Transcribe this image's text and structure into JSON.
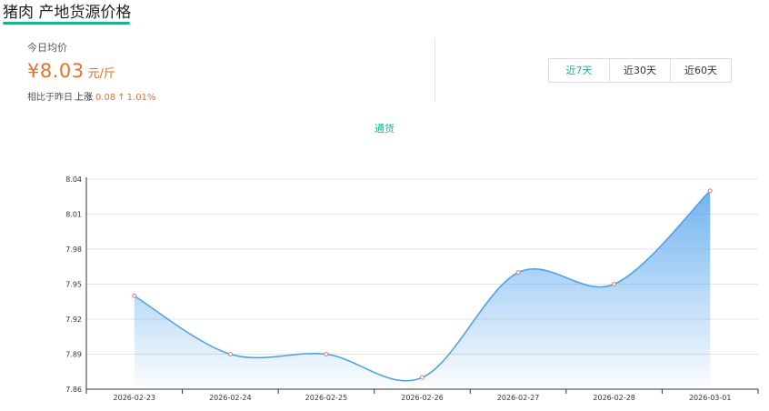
{
  "header": {
    "title": "猪肉 产地货源价格"
  },
  "price_panel": {
    "label": "今日均价",
    "value": "¥8.03",
    "unit": "元/斤",
    "compare_label": "相比于昨日",
    "direction": "上涨",
    "change": "0.08",
    "arrow": "↑",
    "percent": "1.01%"
  },
  "range_tabs": [
    {
      "label": "近7天",
      "active": true
    },
    {
      "label": "近30天",
      "active": false
    },
    {
      "label": "近60天",
      "active": false
    }
  ],
  "colors": {
    "accent": "#19b394",
    "price": "#e4722a",
    "line": "#4a9fe0",
    "point": "#e57373"
  },
  "chart_data": {
    "type": "area",
    "title": "",
    "legend": [
      "通货"
    ],
    "legend_position": "top-center",
    "x": [
      "2026-02-23",
      "2026-02-24",
      "2026-02-25",
      "2026-02-26",
      "2026-02-27",
      "2026-02-28",
      "2026-03-01"
    ],
    "series": [
      {
        "name": "通货",
        "values": [
          7.94,
          7.89,
          7.89,
          7.87,
          7.96,
          7.95,
          8.03
        ],
        "smooth": true
      }
    ],
    "ylim": [
      7.86,
      8.04
    ],
    "yticks": [
      "7.86",
      "7.89",
      "7.92",
      "7.95",
      "7.98",
      "8.01",
      "8.04"
    ],
    "grid": true
  }
}
